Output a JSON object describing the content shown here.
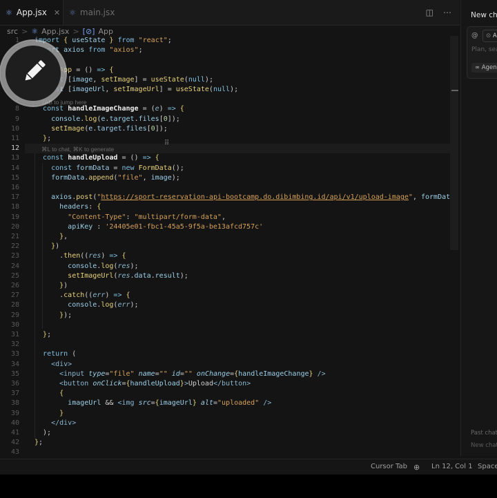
{
  "tabs": [
    {
      "label": "App.jsx",
      "active": true
    },
    {
      "label": "main.jsx",
      "active": false
    }
  ],
  "breadcrumb": {
    "folder": "src",
    "file": "App.jsx",
    "symbol": "App"
  },
  "hints": {
    "tab_jump": "TAB to jump here",
    "chat_generate": "⌘L to chat, ⌘K to generate"
  },
  "current_line": 12,
  "chat": {
    "title": "New cha",
    "at": "@",
    "chip": "A",
    "placeholder": "Plan, sea",
    "agent": "∞ Agen",
    "past_chats": "Past chats",
    "new_chat": "New chat"
  },
  "status": {
    "cursor_tab": "Cursor Tab",
    "position": "Ln 12, Col 1",
    "spaces": "Space"
  },
  "code": {
    "url": "https://sport-reservation-api-bootcamp.do.dibimbing.id/api/v1/upload-image",
    "api_key": "'24405e01-fbc1-45a5-9f5a-be13afcd757c'"
  }
}
